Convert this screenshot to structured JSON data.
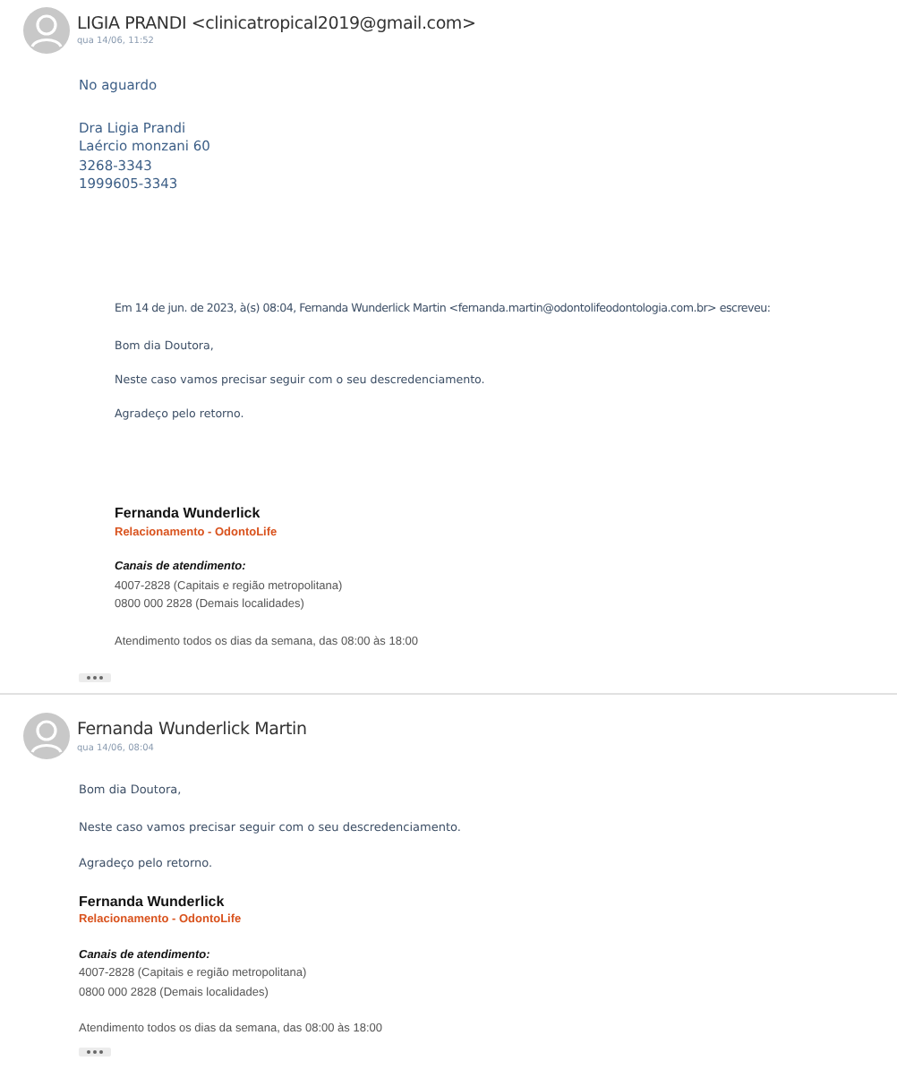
{
  "messages": [
    {
      "sender": "LIGIA PRANDI",
      "email": "<clinicatropical2019@gmail.com>",
      "date": "qua 14/06, 11:52",
      "body": [
        {
          "kind": "text",
          "lines": [
            "No aguardo"
          ]
        },
        {
          "kind": "text",
          "lines": [
            "Dra Ligia Prandi",
            "Laércio monzani 60",
            "3268-3343",
            "1999605-3343"
          ]
        },
        {
          "kind": "quote",
          "header": "Em 14 de jun. de 2023, à(s) 08:04, Fernanda Wunderlick Martin <fernanda.martin@odontolifeodontologia.com.br> escreveu:",
          "paragraphs": [
            "Bom dia Doutora,",
            "Neste caso vamos precisar seguir com o seu descredenciamento.",
            "Agradeço pelo retorno."
          ],
          "signature": {
            "name": "Fernanda Wunderlick",
            "role": "Relacionamento - OdontoLife",
            "channels_title": "Canais de atendimento:",
            "channels": [
              "4007-2828 (Capitais e região metropolitana)",
              "0800 000 2828 (Demais localidades)"
            ],
            "hours": "Atendimento todos os dias da semana, das 08:00 às 18:00"
          }
        }
      ]
    },
    {
      "sender": "Fernanda Wunderlick Martin",
      "date": "qua 14/06, 08:04",
      "body": [
        {
          "kind": "paragraphs",
          "paragraphs": [
            "Bom dia Doutora,",
            "Neste caso vamos precisar seguir com o seu descredenciamento.",
            "Agradeço pelo retorno."
          ]
        },
        {
          "kind": "signature",
          "signature": {
            "name": "Fernanda Wunderlick",
            "role": "Relacionamento - OdontoLife",
            "channels_title": "Canais de atendimento:",
            "channels": [
              "4007-2828 (Capitais e região metropolitana)",
              "0800 000 2828 (Demais localidades)"
            ],
            "hours": "Atendimento todos os dias da semana, das 08:00 às 18:00"
          }
        }
      ]
    }
  ]
}
